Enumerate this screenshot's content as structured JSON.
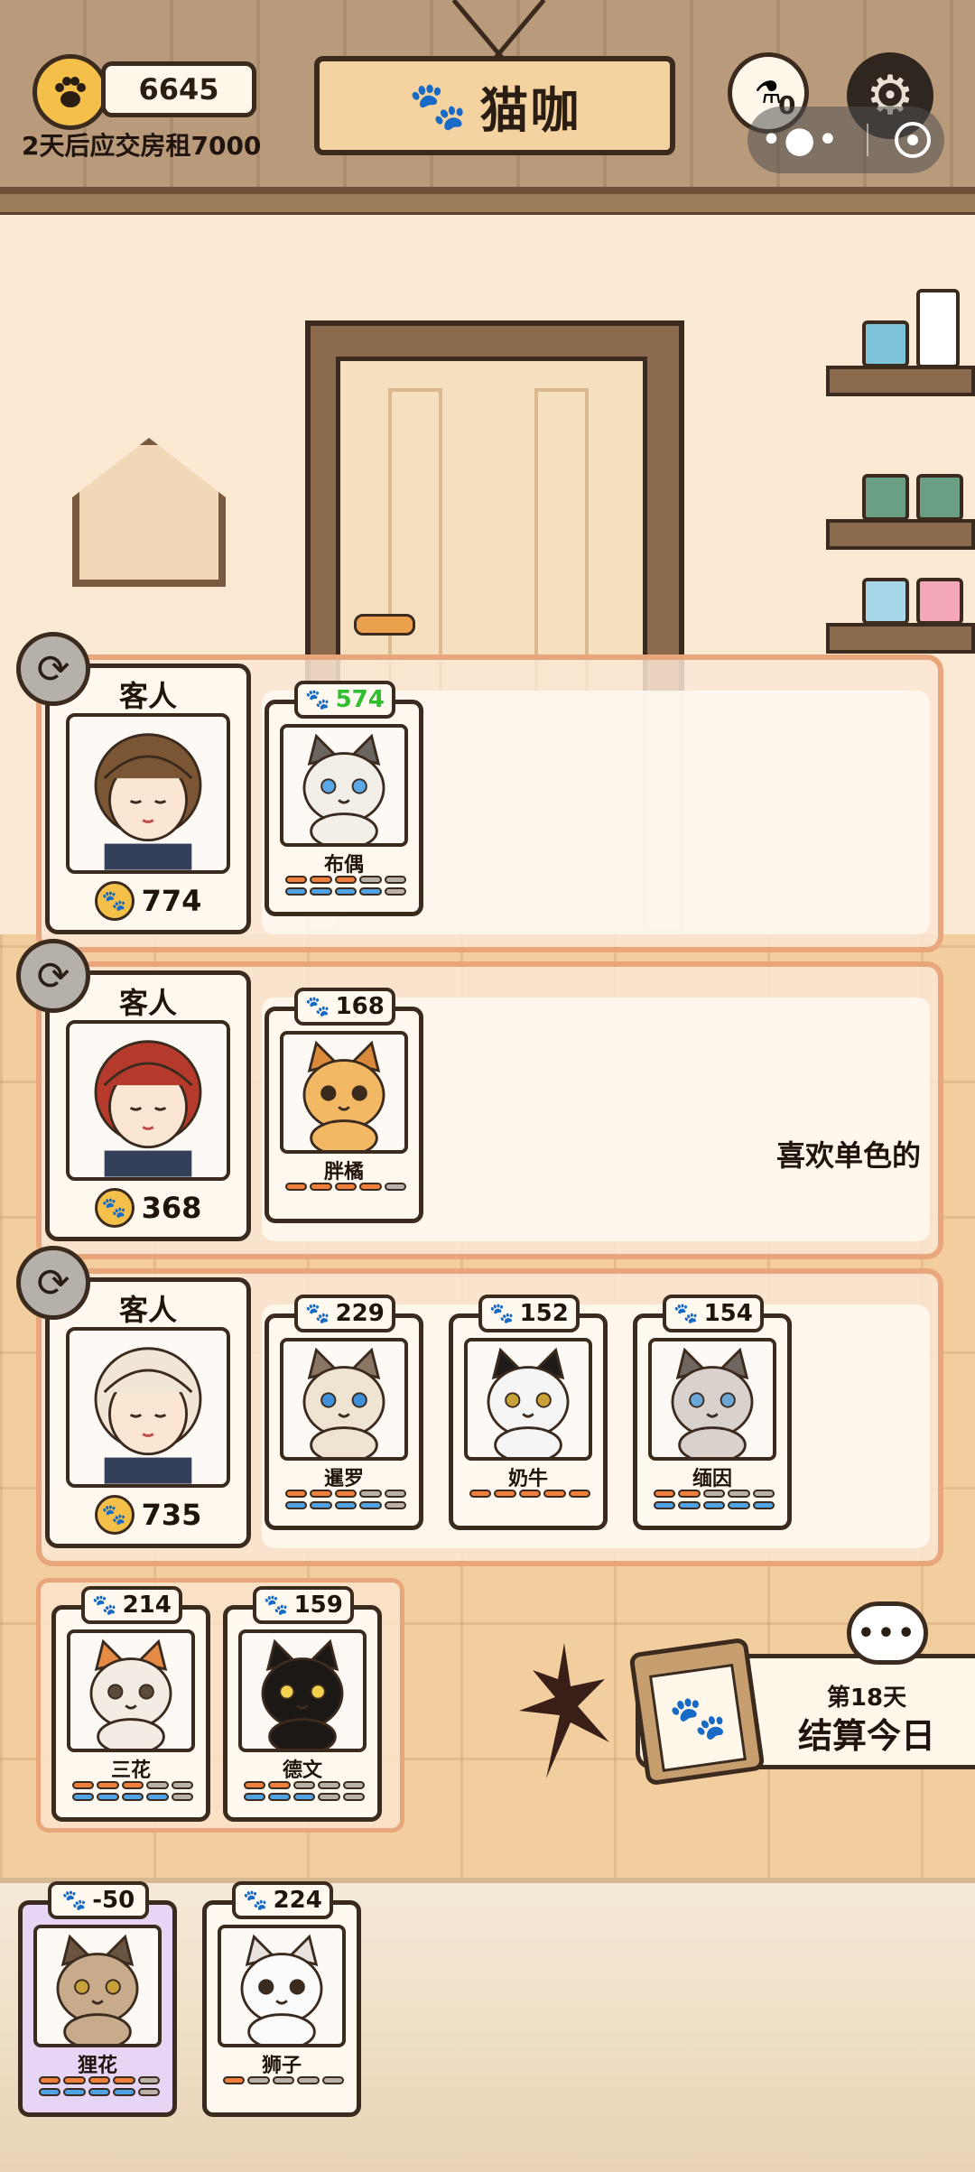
{
  "hud": {
    "coins": "6645",
    "rent_notice": "2天后应交房租7000",
    "title": "猫咖",
    "potion_count": "0"
  },
  "guest_label": "客人",
  "customers": [
    {
      "label": "客人",
      "coins": "774",
      "request": "",
      "cats": [
        {
          "score": "574",
          "name": "布偶",
          "highlight": true,
          "stats": [
            [
              "o",
              "o",
              "o",
              "g",
              "g"
            ],
            [
              "b",
              "b",
              "b",
              "b",
              "g"
            ]
          ]
        }
      ]
    },
    {
      "label": "客人",
      "coins": "368",
      "request": "喜欢单色的",
      "cats": [
        {
          "score": "168",
          "name": "胖橘",
          "highlight": false,
          "stats": [
            [
              "o",
              "o",
              "o",
              "o",
              "g"
            ]
          ]
        }
      ]
    },
    {
      "label": "客人",
      "coins": "735",
      "request": "",
      "cats": [
        {
          "score": "229",
          "name": "暹罗",
          "stats": [
            [
              "o",
              "o",
              "o",
              "g",
              "g"
            ],
            [
              "b",
              "b",
              "b",
              "b",
              "g"
            ]
          ]
        },
        {
          "score": "152",
          "name": "奶牛",
          "stats": [
            [
              "o",
              "o",
              "o",
              "o",
              "o"
            ]
          ]
        },
        {
          "score": "154",
          "name": "缅因",
          "stats": [
            [
              "o",
              "o",
              "g",
              "g",
              "g"
            ],
            [
              "b",
              "b",
              "b",
              "b",
              "b"
            ]
          ]
        }
      ]
    }
  ],
  "waiting_cats": [
    {
      "score": "214",
      "name": "三花",
      "stats": [
        [
          "o",
          "o",
          "o",
          "g",
          "g"
        ],
        [
          "b",
          "b",
          "b",
          "b",
          "g"
        ]
      ]
    },
    {
      "score": "159",
      "name": "德文",
      "stats": [
        [
          "o",
          "o",
          "g",
          "g",
          "g"
        ],
        [
          "b",
          "b",
          "b",
          "g",
          "g"
        ]
      ]
    }
  ],
  "reserve_cats": [
    {
      "score": "-50",
      "name": "狸花",
      "stats": [
        [
          "o",
          "o",
          "o",
          "o",
          "g"
        ],
        [
          "b",
          "b",
          "b",
          "b",
          "g"
        ]
      ]
    },
    {
      "score": "224",
      "name": "狮子",
      "stats": [
        [
          "o",
          "g",
          "g",
          "g",
          "g"
        ]
      ]
    }
  ],
  "day": {
    "label": "第18天",
    "button": "结算今日"
  },
  "chat_bubble": "•••",
  "colors": {
    "accent_orange": "#ef7f3a",
    "accent_blue": "#4fa2e4",
    "coin_gold": "#f4c04a",
    "highlight_green": "#2fbf2f",
    "outline": "#3b2a1e"
  },
  "icons": [
    "paw-icon",
    "potion-icon",
    "gear-icon",
    "refresh-icon",
    "clipboard-icon",
    "chat-icon",
    "more-dots-icon",
    "close-circle-icon"
  ]
}
